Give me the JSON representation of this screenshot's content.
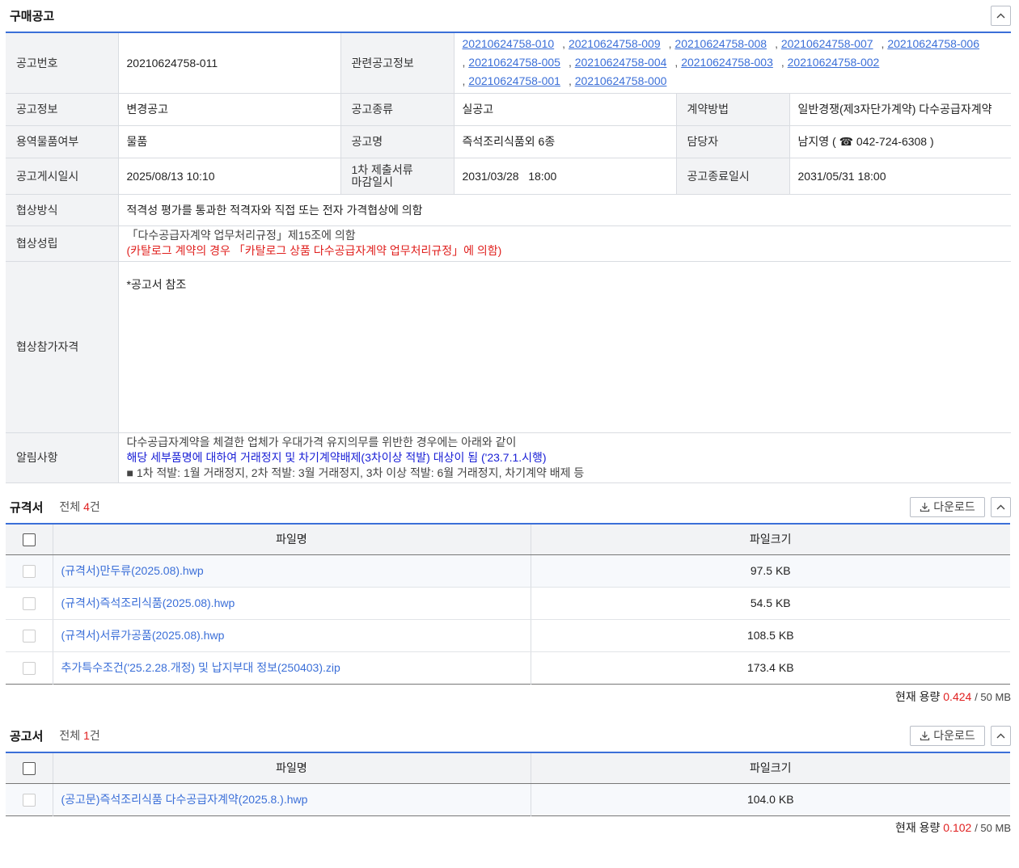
{
  "header": {
    "title": "구매공고"
  },
  "info": {
    "notice_no_label": "공고번호",
    "notice_no": "20210624758-011",
    "related_label": "관련공고정보",
    "related": [
      "20210624758-010",
      "20210624758-009",
      "20210624758-008",
      "20210624758-007",
      "20210624758-006",
      "20210624758-005",
      "20210624758-004",
      "20210624758-003",
      "20210624758-002",
      "20210624758-001",
      "20210624758-000"
    ],
    "notice_info_label": "공고정보",
    "notice_info": "변경공고",
    "notice_type_label": "공고종류",
    "notice_type": "실공고",
    "contract_method_label": "계약방법",
    "contract_method": "일반경쟁(제3자단가계약) 다수공급자계약",
    "service_goods_label": "용역물품여부",
    "service_goods": "물품",
    "notice_name_label": "공고명",
    "notice_name": "즉석조리식품외 6종",
    "manager_label": "담당자",
    "manager": "남지영 ( ☎ 042-724-6308 )",
    "posted_label": "공고게시일시",
    "posted": "2025/08/13 10:10",
    "first_deadline_label_1": "1차 제출서류",
    "first_deadline_label_2": "마감일시",
    "first_deadline": "2031/03/28   18:00",
    "end_label": "공고종료일시",
    "end": "2031/05/31 18:00",
    "negotiation_method_label": "협상방식",
    "negotiation_method": "적격성 평가를 통과한 적격자와 직접 또는 전자 가격협상에 의함",
    "negotiation_conclusion_label": "협상성립",
    "negotiation_conclusion_1": "「다수공급자계약 업무처리규정」제15조에 의함",
    "negotiation_conclusion_2": "(카탈로그 계약의 경우 「카탈로그 상품 다수공급자계약 업무처리규정」에 의함)",
    "qualification_label": "협상참가자격",
    "qualification": "*공고서 참조",
    "notice_label": "알림사항",
    "notice_1": "다수공급자계약을 체결한 업체가 우대가격 유지의무를 위반한 경우에는 아래와 같이",
    "notice_2": "해당 세부품명에 대하여 거래정지 및 차기계약배제(3차이상 적발) 대상이 됨 ('23.7.1.시행)",
    "notice_3": "■ 1차 적발: 1월 거래정지, 2차 적발: 3월 거래정지, 3차 이상 적발: 6월 거래정지, 차기계약 배제 등"
  },
  "spec": {
    "title": "규격서",
    "count_prefix": "전체",
    "count": "4",
    "count_suffix": "건",
    "download_label": "다운로드",
    "col_name": "파일명",
    "col_size": "파일크기",
    "files": [
      {
        "name": "(규격서)만두류(2025.08).hwp",
        "size": "97.5 KB"
      },
      {
        "name": "(규격서)즉석조리식품(2025.08).hwp",
        "size": "54.5 KB"
      },
      {
        "name": "(규격서)서류가공품(2025.08).hwp",
        "size": "108.5 KB"
      },
      {
        "name": "추가특수조건('25.2.28.개정) 및 납지부대 정보(250403).zip",
        "size": "173.4 KB"
      }
    ],
    "capacity_label": "현재 용량",
    "capacity_used": "0.424",
    "capacity_total": "/ 50 MB"
  },
  "announce": {
    "title": "공고서",
    "count_prefix": "전체",
    "count": "1",
    "count_suffix": "건",
    "download_label": "다운로드",
    "col_name": "파일명",
    "col_size": "파일크기",
    "files": [
      {
        "name": "(공고문)즉석조리식품 다수공급자계약(2025.8.).hwp",
        "size": "104.0 KB"
      }
    ],
    "capacity_label": "현재 용량",
    "capacity_used": "0.102",
    "capacity_total": "/ 50 MB"
  },
  "icons": {
    "collapse": "chevron-up-icon",
    "download": "download-icon",
    "phone": "phone-icon"
  },
  "colors": {
    "accent": "#3b6fd8",
    "red": "#e0201e",
    "blue": "#1a20d6"
  }
}
